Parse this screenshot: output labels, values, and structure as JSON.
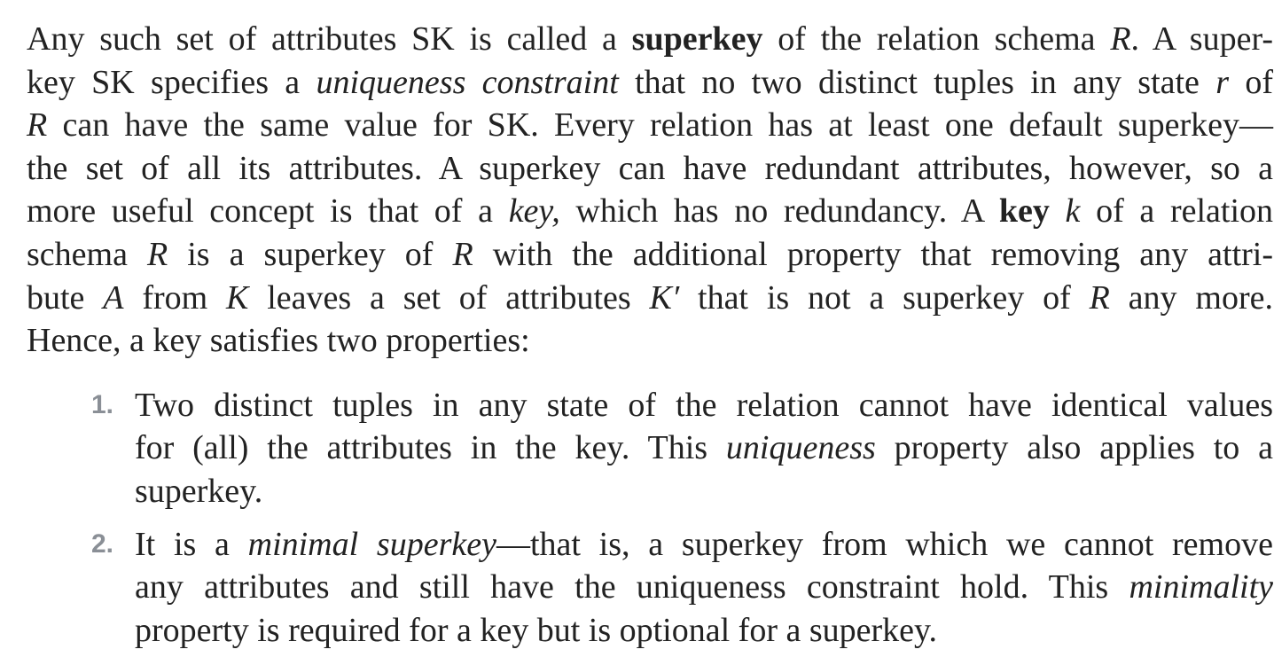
{
  "paragraph": {
    "lines": [
      [
        {
          "t": "Any such set of attributes SK is called a "
        },
        {
          "t": "superkey",
          "s": "b"
        },
        {
          "t": " of the relation schema "
        },
        {
          "t": "R",
          "s": "i"
        },
        {
          "t": ". A super-"
        }
      ],
      [
        {
          "t": "key SK specifies a "
        },
        {
          "t": "uniqueness constraint",
          "s": "i"
        },
        {
          "t": " that no two distinct tuples in any state "
        },
        {
          "t": "r",
          "s": "i"
        },
        {
          "t": " of"
        }
      ],
      [
        {
          "t": "R",
          "s": "i"
        },
        {
          "t": " can have the same value for SK. Every relation has at least one default superkey—"
        }
      ],
      [
        {
          "t": "the set of all its attributes. A superkey can have redundant attributes, however, so a"
        }
      ],
      [
        {
          "t": "more useful concept is that of a "
        },
        {
          "t": "key,",
          "s": "i"
        },
        {
          "t": " which has no redundancy. A "
        },
        {
          "t": "key",
          "s": "b"
        },
        {
          "t": " "
        },
        {
          "t": "k",
          "s": "i"
        },
        {
          "t": " of a relation"
        }
      ],
      [
        {
          "t": "schema "
        },
        {
          "t": "R",
          "s": "i"
        },
        {
          "t": " is a superkey of "
        },
        {
          "t": "R",
          "s": "i"
        },
        {
          "t": " with the additional property that removing any attri-"
        }
      ],
      [
        {
          "t": "bute "
        },
        {
          "t": "A",
          "s": "i"
        },
        {
          "t": " from "
        },
        {
          "t": "K",
          "s": "i"
        },
        {
          "t": " leaves a set of attributes "
        },
        {
          "t": "K′",
          "s": "i"
        },
        {
          "t": " that is not a superkey of "
        },
        {
          "t": "R",
          "s": "i"
        },
        {
          "t": " any more."
        }
      ],
      [
        {
          "t": "Hence, a key satisfies two properties:"
        }
      ]
    ],
    "justified": [
      true,
      true,
      true,
      true,
      true,
      true,
      true,
      false
    ]
  },
  "list": {
    "items": [
      {
        "number": "1.",
        "lines": [
          [
            {
              "t": "Two distinct tuples in any state of the relation cannot have identical values"
            }
          ],
          [
            {
              "t": "for (all) the attributes in the key. This "
            },
            {
              "t": "uniqueness",
              "s": "i"
            },
            {
              "t": " property also applies to a"
            }
          ],
          [
            {
              "t": "superkey."
            }
          ]
        ],
        "justified": [
          true,
          true,
          false
        ]
      },
      {
        "number": "2.",
        "lines": [
          [
            {
              "t": "It is a "
            },
            {
              "t": "minimal superkey",
              "s": "i"
            },
            {
              "t": "—that is, a superkey from which we cannot remove"
            }
          ],
          [
            {
              "t": "any attributes and still have the uniqueness constraint hold. This "
            },
            {
              "t": "minimality",
              "s": "i"
            }
          ],
          [
            {
              "t": "property is required for a key but is optional for a superkey."
            }
          ]
        ],
        "justified": [
          true,
          true,
          false
        ]
      }
    ]
  }
}
